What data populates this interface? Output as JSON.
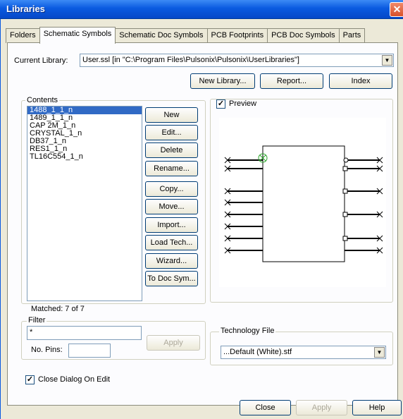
{
  "window": {
    "title": "Libraries",
    "close_glyph": "✕"
  },
  "tabs": [
    {
      "label": "Folders",
      "active": false
    },
    {
      "label": "Schematic Symbols",
      "active": true
    },
    {
      "label": "Schematic Doc Symbols",
      "active": false
    },
    {
      "label": "PCB Footprints",
      "active": false
    },
    {
      "label": "PCB Doc Symbols",
      "active": false
    },
    {
      "label": "Parts",
      "active": false
    }
  ],
  "current_library": {
    "label": "Current Library:",
    "value": "User.ssl   [in \"C:\\Program Files\\Pulsonix\\Pulsonix\\UserLibraries\"]"
  },
  "top_buttons": {
    "new_library": "New Library...",
    "report": "Report...",
    "index": "Index"
  },
  "contents": {
    "title": "Contents",
    "items": [
      "1488_1_1_n",
      "1489_1_1_n",
      "CAP 2M_1_n",
      "CRYSTAL_1_n",
      "DB37_1_n",
      "RES1_1_n",
      "TL16C554_1_n"
    ],
    "selected_index": 0,
    "matched": "Matched: 7 of 7"
  },
  "side_buttons": {
    "new": "New",
    "edit": "Edit...",
    "delete": "Delete",
    "rename": "Rename...",
    "copy": "Copy...",
    "move": "Move...",
    "import": "Import...",
    "load_tech": "Load Tech...",
    "wizard": "Wizard...",
    "to_doc_sym": "To Doc Sym..."
  },
  "filter": {
    "title": "Filter",
    "value": "*",
    "no_pins_label": "No. Pins:",
    "no_pins_value": "",
    "apply": "Apply"
  },
  "preview": {
    "label": "Preview",
    "checked": true
  },
  "technology_file": {
    "title": "Technology File",
    "value": "...Default (White).stf"
  },
  "close_dialog_on_edit": {
    "label": "Close Dialog On Edit",
    "checked": true
  },
  "bottom_buttons": {
    "close": "Close",
    "apply": "Apply",
    "help": "Help"
  },
  "colors": {
    "title_bar": "#0a5ae0",
    "selection": "#316ac5",
    "dialog_bg": "#ece9d8",
    "origin_marker": "#2aa52a"
  }
}
